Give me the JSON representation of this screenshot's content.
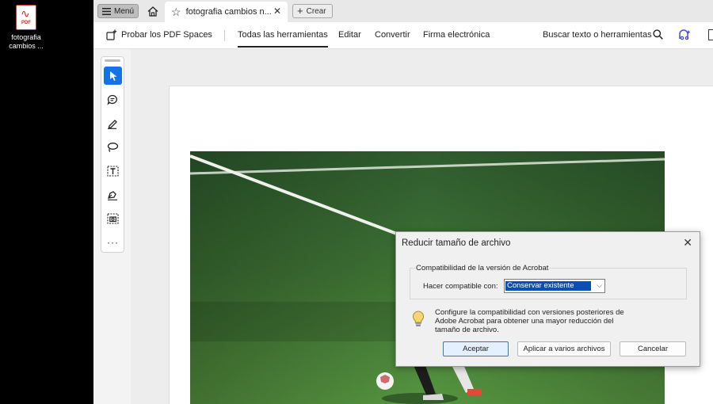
{
  "desktop": {
    "file_icon_tag": "PDF",
    "file_name": "fotografia cambios ..."
  },
  "tabbar": {
    "menu_label": "Menú",
    "tab_title": "fotografia cambios n...",
    "create_label": "Crear"
  },
  "toolbar": {
    "spaces_label": "Probar los PDF Spaces",
    "all_tools": "Todas las herramientas",
    "edit": "Editar",
    "convert": "Convertir",
    "sign": "Firma electrónica",
    "search": "Buscar texto o herramientas"
  },
  "dialog": {
    "title": "Reducir tamaño de archivo",
    "group_label": "Compatibilidad de la versión de Acrobat",
    "compat_label": "Hacer compatible con:",
    "compat_value": "Conservar existente",
    "info_text": "Configure la compatibilidad con versiones posteriores de Adobe Acrobat para obtener una mayor reducción del tamaño de archivo.",
    "btn_accept": "Aceptar",
    "btn_multiple": "Aplicar a varios archivos",
    "btn_cancel": "Cancelar"
  },
  "colors": {
    "accent": "#1473e6",
    "pitch": "#3f7a35",
    "selection": "#0a4fb8"
  }
}
